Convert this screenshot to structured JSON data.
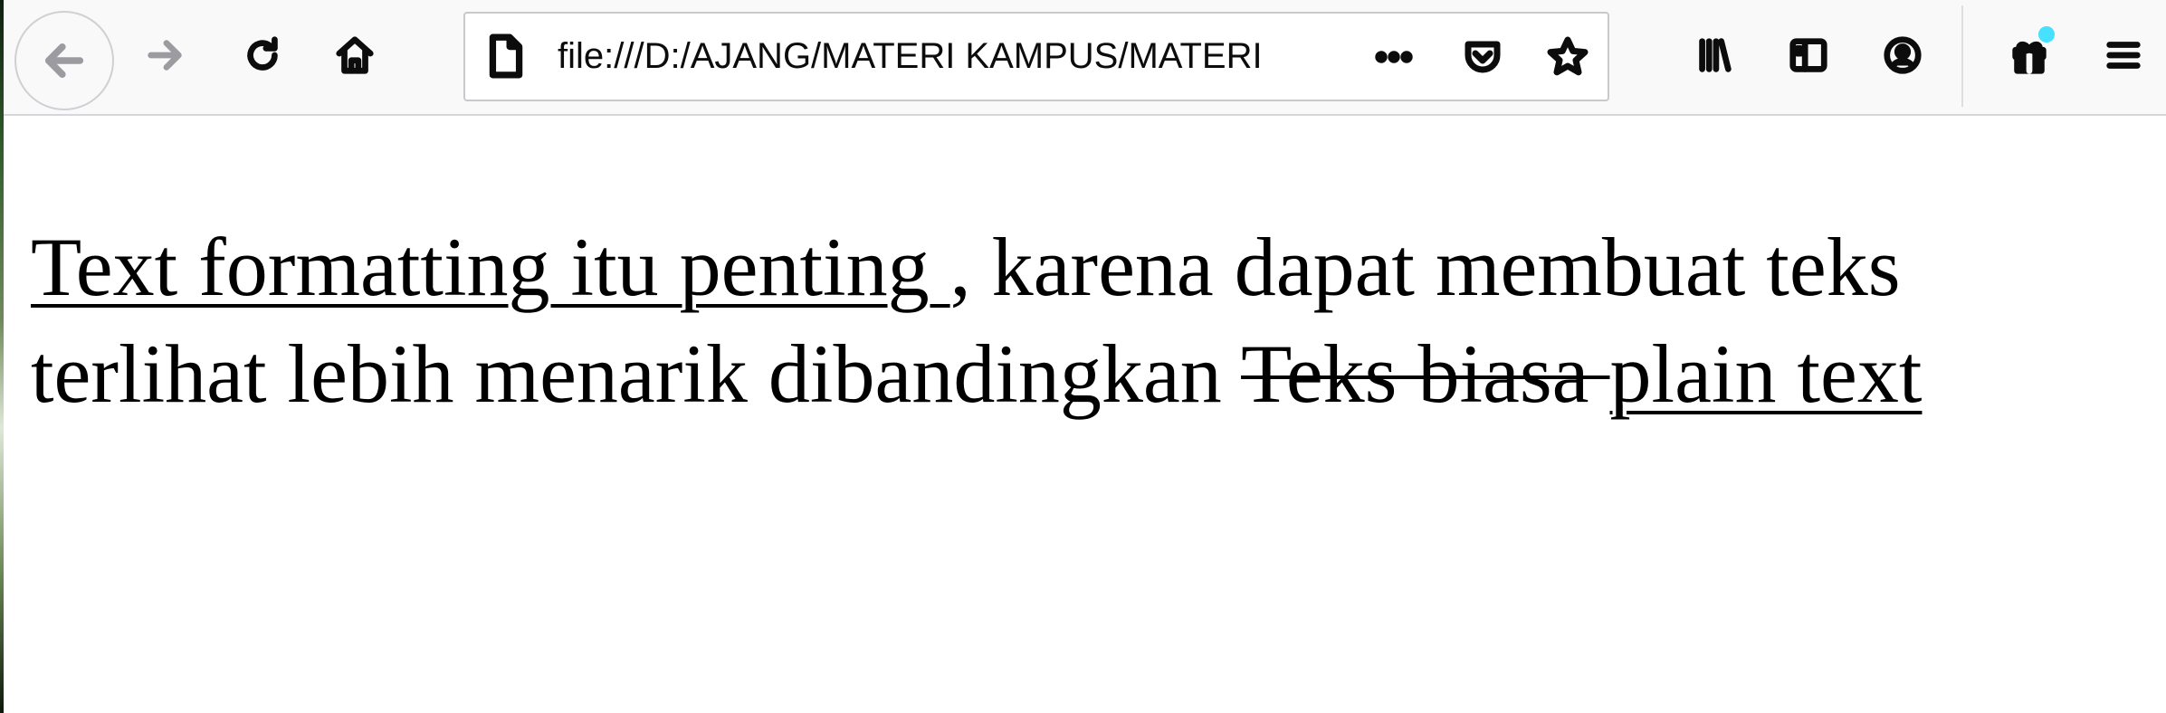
{
  "window": {
    "url": "file:///D:/AJANG/MATERI KAMPUS/MATERI"
  },
  "toolbar": {
    "buttons": [
      "back-arrow-icon",
      "forward-arrow-icon",
      "reload-icon",
      "home-icon"
    ],
    "url_icons": [
      "page-icon",
      "more-dots-icon",
      "pocket-icon",
      "star-icon"
    ],
    "right_buttons": [
      "library-icon",
      "sidebar-icon",
      "account-icon",
      "whats-new-icon",
      "hamburger-menu-icon"
    ],
    "accent_dot_color": "#45e1ff"
  },
  "content": {
    "underlined_phrase": "Text formatting itu penting ",
    "normal_text": ", karena dapat membuat teks terlihat lebih menarik dibandingkan ",
    "struck_text": "Teks biasa ",
    "underlined_end": "plain text"
  }
}
